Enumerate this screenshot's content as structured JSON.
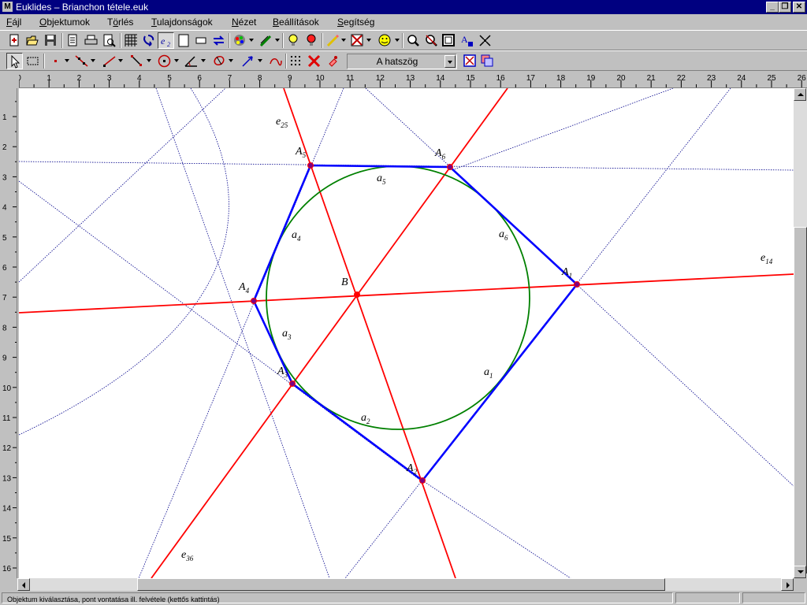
{
  "window": {
    "title": "Euklides – Brianchon tétele.euk",
    "app_icon": "M"
  },
  "menu": [
    {
      "pre": "",
      "u": "F",
      "post": "ájl"
    },
    {
      "pre": "",
      "u": "O",
      "post": "bjektumok"
    },
    {
      "pre": "T",
      "u": "ö",
      "post": "rlés"
    },
    {
      "pre": "",
      "u": "T",
      "post": "ulajdonságok"
    },
    {
      "pre": "",
      "u": "N",
      "post": "ézet"
    },
    {
      "pre": "",
      "u": "B",
      "post": "eállítások"
    },
    {
      "pre": "",
      "u": "S",
      "post": "egítség"
    }
  ],
  "toolbar": {
    "construction_select": "A hatszög",
    "icons_row1": [
      "new-file-icon",
      "open-folder-icon",
      "save-disk-icon",
      "document-icon",
      "print-icon",
      "print-preview-icon",
      "grid-icon",
      "redraw-icon",
      "label-e2-icon",
      "blank-page-icon",
      "window-icon",
      "swap-arrows-icon",
      "color-palette-icon",
      "pen-width-icon",
      "lightbulb-icon",
      "red-lightbulb-icon",
      "pencil-icon",
      "hide-object-icon",
      "smiley-icon",
      "zoom-icon",
      "zoom-out-icon",
      "frame-icon",
      "font-icon",
      "shrink-icon"
    ],
    "icons_row2": [
      "select-arrow-icon",
      "select-rectangle-icon",
      "point-tool-icon",
      "line-tool-icon",
      "ray-tool-icon",
      "segment-tool-icon",
      "circle-tool-icon",
      "angle-tool-icon",
      "transform-tool-icon",
      "vector-tool-icon",
      "arc-tool-icon",
      "grid-points-icon",
      "delete-x-icon",
      "eraser-icon",
      "run-macro-icon",
      "copy-macro-icon"
    ],
    "e2_label": "e2"
  },
  "rulers": {
    "horizontal": [
      "0",
      "1",
      "2",
      "3",
      "4",
      "5",
      "6",
      "7",
      "8",
      "9",
      "10",
      "11",
      "12",
      "13",
      "14",
      "15",
      "16",
      "17",
      "18",
      "19",
      "20",
      "21",
      "22",
      "23",
      "24",
      "25",
      "26"
    ],
    "vertical": [
      "1",
      "2",
      "3",
      "4",
      "5",
      "6",
      "7",
      "8",
      "9",
      "10",
      "11",
      "12",
      "13",
      "14",
      "15",
      "16"
    ]
  },
  "construction": {
    "points": [
      "A1",
      "A2",
      "A3",
      "A4",
      "A5",
      "A6",
      "B"
    ],
    "sides": [
      "a1",
      "a2",
      "a3",
      "a4",
      "a5",
      "a6"
    ],
    "diagonals": [
      "e14",
      "e25",
      "e36"
    ],
    "colors": {
      "hexagon": "#0000ff",
      "incircle": "#008000",
      "diagonals": "#ff0000",
      "auxiliary": "#00008b",
      "point_fill": "#800080"
    }
  },
  "status": {
    "hint": "Objektum kiválasztása, pont vontatása ill. felvétele (kettős kattintás)"
  }
}
